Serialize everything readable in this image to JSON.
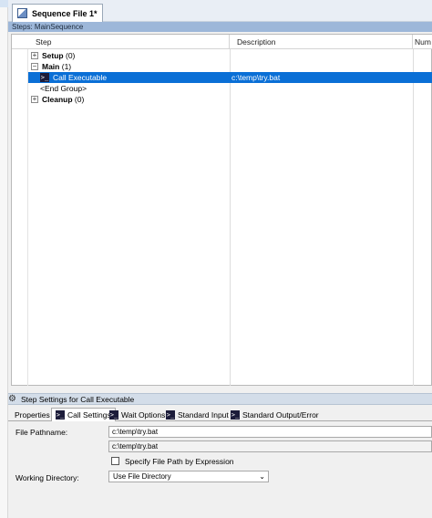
{
  "document_tab": {
    "title": "Sequence File 1*"
  },
  "steps_header": "Steps: MainSequence",
  "columns": [
    "Step",
    "Description",
    "Num"
  ],
  "groups": {
    "setup": {
      "label": "Setup",
      "count": "(0)"
    },
    "main": {
      "label": "Main",
      "count": "(1)"
    },
    "cleanup": {
      "label": "Cleanup",
      "count": "(0)"
    }
  },
  "steps": [
    {
      "name": "Call Executable",
      "description": "c:\\temp\\try.bat",
      "selected": true
    }
  ],
  "end_group": "<End Group>",
  "step_settings": {
    "title": "Step Settings for Call Executable",
    "tabs": [
      "Properties",
      "Call Settings",
      "Wait Options",
      "Standard Input",
      "Standard Output/Error"
    ],
    "active_tab": "Call Settings",
    "file_pathname_label": "File Pathname:",
    "file_pathname_value": "c:\\temp\\try.bat",
    "file_pathname_resolved": "c:\\temp\\try.bat",
    "specify_expr_label": "Specify File Path by Expression",
    "specify_expr_checked": false,
    "working_dir_label": "Working Directory:",
    "working_dir_value": "Use File Directory"
  },
  "icons": {
    "sequence_file": "sequence-file-icon",
    "executable": "call-executable-icon",
    "step_settings": "gear-icon"
  },
  "colors": {
    "selection": "#0a6fd6",
    "steps_header_bg": "#9db7d9"
  }
}
